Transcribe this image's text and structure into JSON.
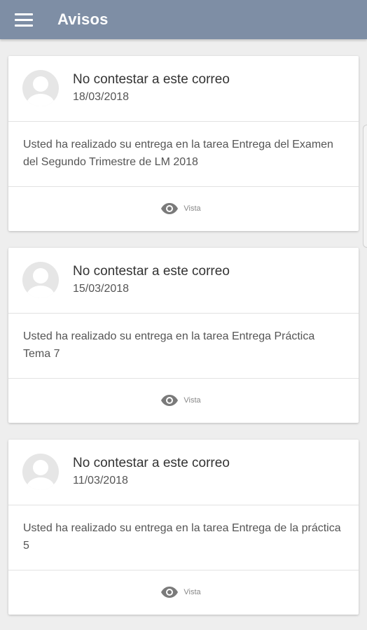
{
  "appbar": {
    "title": "Avisos",
    "menu_icon": "hamburger-menu-icon",
    "background": "#7e8ea5"
  },
  "notices": [
    {
      "sender": "No contestar a este correo",
      "date": "18/03/2018",
      "message": "Usted ha realizado su entrega en la tarea Entrega del Examen del Segundo Trimestre de LM 2018",
      "status_label": "Vista",
      "status_icon": "eye-icon"
    },
    {
      "sender": "No contestar a este correo",
      "date": "15/03/2018",
      "message": "Usted ha realizado su entrega en la tarea Entrega Práctica Tema 7",
      "status_label": "Vista",
      "status_icon": "eye-icon"
    },
    {
      "sender": "No contestar a este correo",
      "date": "11/03/2018",
      "message": "Usted ha realizado su entrega en la tarea Entrega de la práctica 5",
      "status_label": "Vista",
      "status_icon": "eye-icon"
    }
  ]
}
